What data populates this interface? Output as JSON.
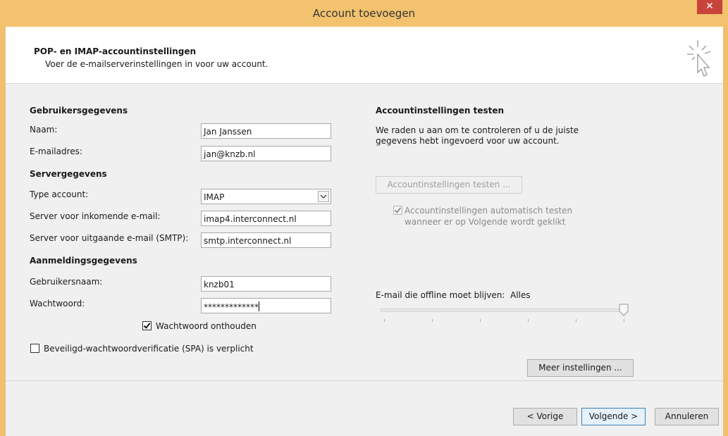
{
  "window": {
    "title": "Account toevoegen",
    "close_symbol": "✕"
  },
  "header": {
    "title": "POP- en IMAP-accountinstellingen",
    "subtitle": "Voer de e-mailserverinstellingen in voor uw account.",
    "icon": "cursor-click-icon"
  },
  "user_info": {
    "heading": "Gebruikersgegevens",
    "name_label": "Naam:",
    "name_value": "Jan Janssen",
    "email_label": "E-mailadres:",
    "email_value": "jan@knzb.nl"
  },
  "server_info": {
    "heading": "Servergegevens",
    "account_type_label": "Type account:",
    "account_type_value": "IMAP",
    "incoming_label": "Server voor inkomende e-mail:",
    "incoming_value": "imap4.interconnect.nl",
    "outgoing_label": "Server voor uitgaande e-mail (SMTP):",
    "outgoing_value": "smtp.interconnect.nl"
  },
  "login_info": {
    "heading": "Aanmeldingsgegevens",
    "username_label": "Gebruikersnaam:",
    "username_value": "knzb01",
    "password_label": "Wachtwoord:",
    "password_value": "*************",
    "remember_label": "Wachtwoord onthouden",
    "remember_checked": true,
    "spa_label": "Beveiligd-wachtwoordverificatie (SPA) is verplicht",
    "spa_checked": false
  },
  "test": {
    "heading": "Accountinstellingen testen",
    "description_line1": "We raden u aan om te controleren of u de juiste",
    "description_line2": "gegevens hebt ingevoerd voor uw account.",
    "test_button": "Accountinstellingen testen ...",
    "auto_test_line1": "Accountinstellingen automatisch testen",
    "auto_test_line2": "wanneer er op Volgende wordt geklikt",
    "auto_test_checked": true
  },
  "offline": {
    "label": "E-mail die offline moet blijven:",
    "value": "Alles",
    "slider_fraction": 1.0
  },
  "more_settings_button": "Meer instellingen ...",
  "footer": {
    "back": "< Vorige",
    "next": "Volgende >",
    "cancel": "Annuleren"
  }
}
